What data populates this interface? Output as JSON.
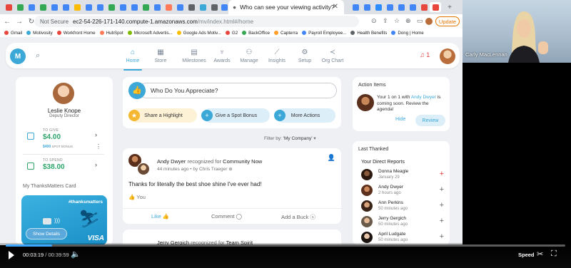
{
  "browser": {
    "active_tab_title": "Who can see your viewing activity?",
    "url_security": "Not Secure",
    "url_host": "ec2-54-226-171-140.compute-1.amazonaws.com",
    "url_path": "/mv/index.html#/home",
    "update_label": "Update",
    "bookmarks": [
      "Gmail",
      "Motivosity",
      "Workfront Home",
      "HubSpot",
      "Microsoft Advertis...",
      "Google Ads Motiv...",
      "G2",
      "BackOffice",
      "Capterra",
      "Payroll Employee...",
      "Health Benefits",
      "Dong | Home"
    ]
  },
  "app_header": {
    "logo_text": "M",
    "nav": [
      {
        "label": "Home",
        "icon": "home-icon"
      },
      {
        "label": "Store",
        "icon": "store-icon"
      },
      {
        "label": "Milestones",
        "icon": "calendar-icon"
      },
      {
        "label": "Awards",
        "icon": "trophy-icon"
      },
      {
        "label": "Manage",
        "icon": "people-icon"
      },
      {
        "label": "Insights",
        "icon": "chart-icon"
      },
      {
        "label": "Setup",
        "icon": "gear-icon"
      },
      {
        "label": "Org Chart",
        "icon": "share-icon"
      }
    ],
    "notification_count": "1"
  },
  "profile": {
    "name": "Leslie Knope",
    "title": "Deputy Director",
    "to_give_label": "TO GIVE",
    "to_give_value": "$4.00",
    "give_sub_amount": "$400",
    "give_sub_label": "SPOT BONUS",
    "to_spend_label": "TO SPEND",
    "to_spend_value": "$38.00",
    "card_section_label": "My ThanksMatters Card",
    "card_tag": "#thanksmatters",
    "show_details": "Show Details",
    "card_brand": "VISA"
  },
  "appreciate": {
    "prompt": "Who Do You Appreciate?",
    "actions": [
      "Share a Highlight",
      "Give a Spot Bonus",
      "More Actions"
    ]
  },
  "feed": {
    "filter_label": "Filter by:",
    "filter_value": "'My Company'",
    "posts": [
      {
        "author": "Andy Dwyer",
        "verb": "recognized for",
        "award": "Community Now",
        "time": "44 minutes ago",
        "by": "by Chris Traeger",
        "body": "Thanks for literally the best shoe shine I've ever had!",
        "likes": "You",
        "like_label": "Like",
        "comment_label": "Comment",
        "buck_label": "Add a Buck"
      },
      {
        "author": "Jerry Gergich",
        "verb": "recognized for",
        "award": "Team Spirit"
      }
    ]
  },
  "action_items": {
    "heading": "Action Items",
    "text_pre": "Your 1 on 1 with",
    "person": "Andy Dwyer",
    "text_post": "is coming soon. Review the agenda!",
    "hide": "Hide",
    "review": "Review"
  },
  "last_thanked": {
    "heading": "Last Thanked",
    "subheading": "Your Direct Reports",
    "people": [
      {
        "name": "Donna Meagle",
        "when": "January 29",
        "highlight": true
      },
      {
        "name": "Andy Dwyer",
        "when": "2 hours ago",
        "highlight": false
      },
      {
        "name": "Ann Perkins",
        "when": "50 minutes ago",
        "highlight": false
      },
      {
        "name": "Jerry Gergich",
        "when": "50 minutes ago",
        "highlight": false
      },
      {
        "name": "April Ludgate",
        "when": "50 minutes ago",
        "highlight": false
      }
    ]
  },
  "webcam": {
    "name": "Carly MacLennan"
  },
  "player": {
    "current_time": "00:03:19",
    "total_time": "00:39:59",
    "progress_fraction": 0.083,
    "speed_label": "Speed"
  },
  "colors": {
    "accent": "#3ba8d8",
    "money": "#2ea46b",
    "alert": "#e03b3b",
    "progress": "#3ea6ff"
  }
}
